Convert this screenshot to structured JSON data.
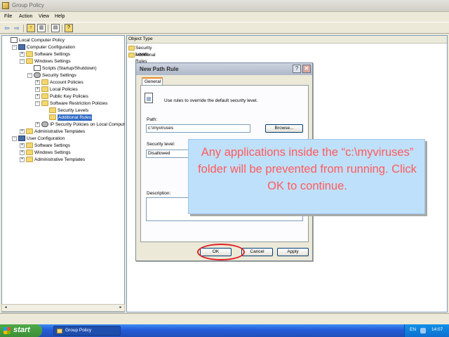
{
  "window": {
    "title": "Group Policy"
  },
  "menu": [
    "File",
    "Action",
    "View",
    "Help"
  ],
  "toolbar": {
    "back_icon": "back-arrow-icon",
    "forward_icon": "forward-arrow-icon",
    "up_icon": "up-folder-icon",
    "showhide_icon": "show-hide-tree-icon",
    "export_icon": "export-list-icon",
    "help_icon": "help-icon"
  },
  "tree": [
    {
      "label": "Local Computer Policy",
      "level": 0,
      "icon": "policy-icon",
      "expander": ""
    },
    {
      "label": "Computer Configuration",
      "level": 1,
      "icon": "computer-icon",
      "expander": "−"
    },
    {
      "label": "Software Settings",
      "level": 2,
      "icon": "folder-icon",
      "expander": "+"
    },
    {
      "label": "Windows Settings",
      "level": 2,
      "icon": "folder-icon",
      "expander": "−"
    },
    {
      "label": "Scripts (Startup/Shutdown)",
      "level": 3,
      "icon": "document-icon",
      "expander": ""
    },
    {
      "label": "Security Settings",
      "level": 3,
      "icon": "gear-icon",
      "expander": "−"
    },
    {
      "label": "Account Policies",
      "level": 4,
      "icon": "folder-icon",
      "expander": "+"
    },
    {
      "label": "Local Policies",
      "level": 4,
      "icon": "folder-icon",
      "expander": "+"
    },
    {
      "label": "Public Key Policies",
      "level": 4,
      "icon": "folder-icon",
      "expander": "+"
    },
    {
      "label": "Software Restriction Policies",
      "level": 4,
      "icon": "folder-icon",
      "expander": "−"
    },
    {
      "label": "Security Levels",
      "level": 5,
      "icon": "folder-icon",
      "expander": ""
    },
    {
      "label": "Additional Rules",
      "level": 5,
      "icon": "folder-icon",
      "expander": "",
      "selected": true
    },
    {
      "label": "IP Security Policies on Local Computer",
      "level": 4,
      "icon": "gear-icon",
      "expander": "+"
    },
    {
      "label": "Administrative Templates",
      "level": 2,
      "icon": "folder-icon",
      "expander": "+"
    },
    {
      "label": "User Configuration",
      "level": 1,
      "icon": "computer-icon",
      "expander": "−"
    },
    {
      "label": "Software Settings",
      "level": 2,
      "icon": "folder-icon",
      "expander": "+"
    },
    {
      "label": "Windows Settings",
      "level": 2,
      "icon": "folder-icon",
      "expander": "+"
    },
    {
      "label": "Administrative Templates",
      "level": 2,
      "icon": "folder-icon",
      "expander": "+"
    }
  ],
  "right_pane": {
    "column_header": "Object Type",
    "items": [
      "Security Levels",
      "Additional Rules"
    ]
  },
  "dialog": {
    "title": "New Path Rule",
    "help_button": "?",
    "close_button": "✕",
    "tab": "General",
    "intro": "Use rules to override the default security level.",
    "path_label": "Path:",
    "path_value": "c:\\myviruses",
    "browse_label": "Browse...",
    "security_level_label": "Security level:",
    "security_level_value": "Disallowed",
    "description_label": "Description:",
    "ok_label": "OK",
    "cancel_label": "Cancel",
    "apply_label": "Apply"
  },
  "callout": {
    "text": "Any applications inside the “c:\\myviruses” folder will be prevented from running. Click OK to continue."
  },
  "taskbar": {
    "start_label": "start",
    "task_label": "Group Policy",
    "language": "EN",
    "clock": "14:07"
  },
  "colors": {
    "callout_bg": "#bfe0fb",
    "callout_text": "#ff5a5a",
    "highlight_ring": "#e02020",
    "selection": "#316ac5"
  }
}
